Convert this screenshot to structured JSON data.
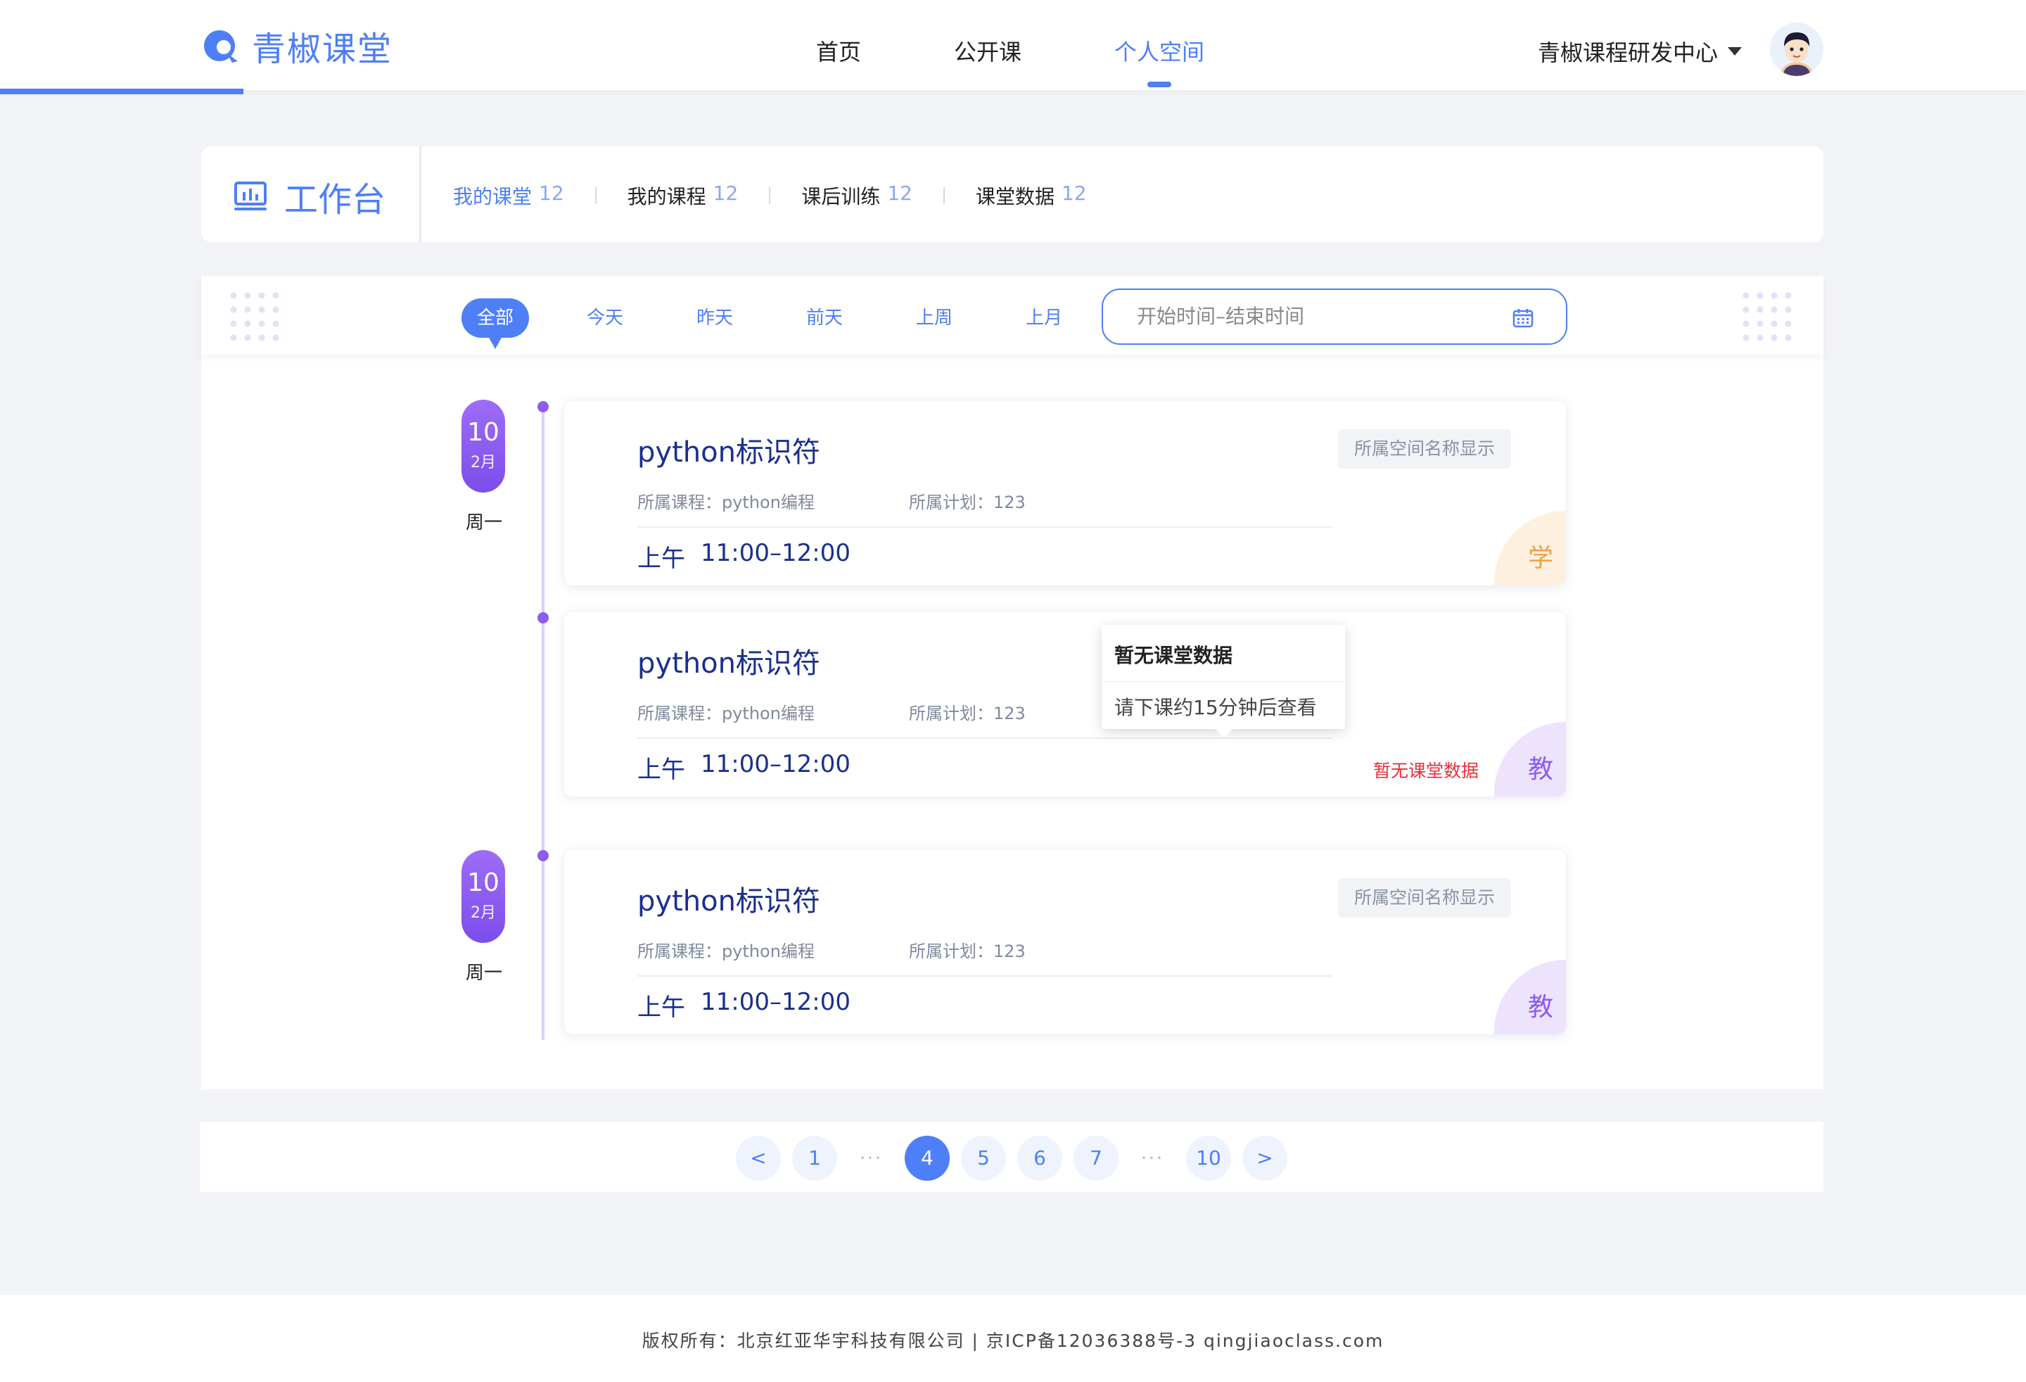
{
  "header": {
    "logo_text": "青椒课堂",
    "nav": [
      {
        "label": "首页",
        "active": false
      },
      {
        "label": "公开课",
        "active": false
      },
      {
        "label": "个人空间",
        "active": true
      }
    ],
    "org_name": "青椒课程研发中心",
    "accent_color": "#4e7ff7"
  },
  "workbench": {
    "title": "工作台",
    "tabs": [
      {
        "label": "我的课堂",
        "count": "12"
      },
      {
        "label": "我的课程",
        "count": "12"
      },
      {
        "label": "课后训练",
        "count": "12"
      },
      {
        "label": "课堂数据",
        "count": "12"
      }
    ]
  },
  "filters": {
    "items": [
      "全部",
      "今天",
      "昨天",
      "前天",
      "上周",
      "上月"
    ],
    "active": "全部",
    "date_placeholder": "开始时间–结束时间"
  },
  "timeline": {
    "groups": [
      {
        "day": "10",
        "month": "2月",
        "weekday": "周一"
      },
      {
        "day": "10",
        "month": "2月",
        "weekday": "周一"
      }
    ]
  },
  "cards": [
    {
      "title": "python标识符",
      "course": "所属课程：python编程",
      "plan": "所属计划：123",
      "period": "上午",
      "time": "11:00–12:00",
      "space_tag": "所属空间名称显示",
      "role": "学"
    },
    {
      "title": "python标识符",
      "course": "所属课程：python编程",
      "plan": "所属计划：123",
      "period": "上午",
      "time": "11:00–12:00",
      "no_data_link": "暂无课堂数据",
      "role": "教"
    },
    {
      "title": "python标识符",
      "course": "所属课程：python编程",
      "plan": "所属计划：123",
      "period": "上午",
      "time": "11:00–12:00",
      "space_tag": "所属空间名称显示",
      "role": "教"
    }
  ],
  "tooltip": {
    "title": "暂无课堂数据",
    "body": "请下课约15分钟后查看"
  },
  "pagination": {
    "prev": "<",
    "next": ">",
    "pages": [
      "1",
      "···",
      "4",
      "5",
      "6",
      "7",
      "···",
      "10"
    ],
    "current": "4"
  },
  "footer": {
    "text": "版权所有：北京红亚华宇科技有限公司 | 京ICP备12036388号-3 qingjiaoclass.com"
  }
}
